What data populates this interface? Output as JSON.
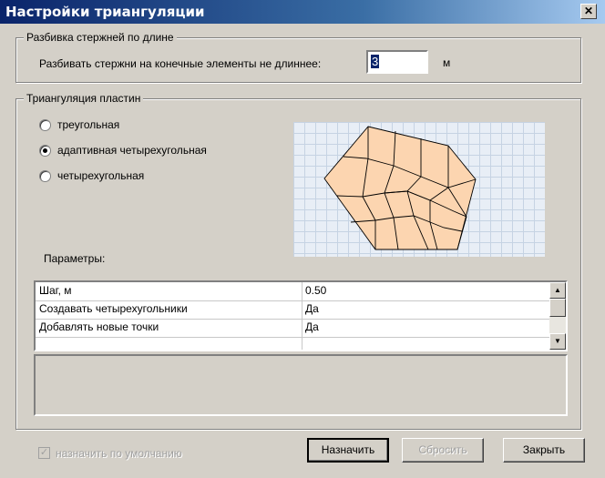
{
  "window": {
    "title": "Настройки триангуляции",
    "close_icon": "close-icon"
  },
  "rod_split": {
    "legend": "Разбивка стержней по длине",
    "label": "Разбивать стержни на конечные элементы не длиннее:",
    "value": "3",
    "unit": "м"
  },
  "plate_triangulation": {
    "legend": "Триангуляция пластин",
    "options": [
      {
        "label": "треугольная",
        "checked": false
      },
      {
        "label": "адаптивная четырехугольная",
        "checked": true
      },
      {
        "label": "четырехугольная",
        "checked": false
      }
    ],
    "preview_fill": "#fcd5b0",
    "params_label": "Параметры:"
  },
  "params_table": {
    "rows": [
      {
        "name": "Шаг, м",
        "value": "0.50"
      },
      {
        "name": "Создавать четырехугольники",
        "value": "Да"
      },
      {
        "name": "Добавлять новые точки",
        "value": "Да"
      },
      {
        "name": "",
        "value": ""
      }
    ]
  },
  "footer": {
    "default_checkbox_label": "назначить по умолчанию",
    "assign_button": "Назначить",
    "reset_button": "Сбросить",
    "close_button": "Закрыть"
  }
}
